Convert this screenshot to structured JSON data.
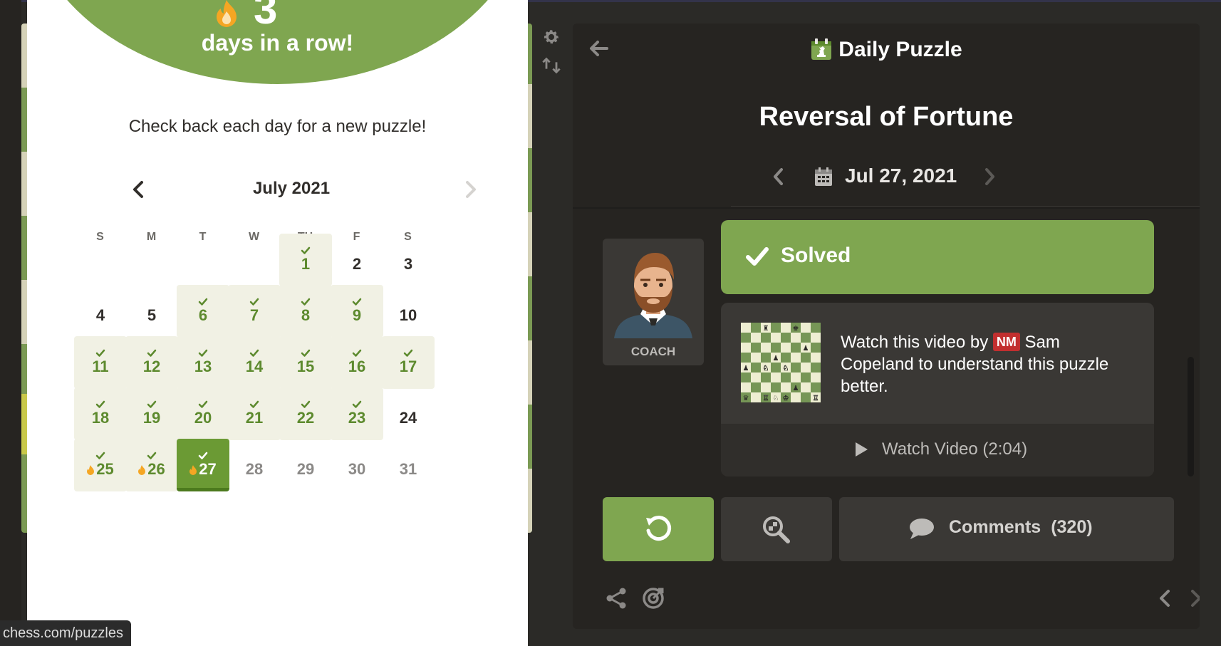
{
  "modal": {
    "streak_number": "3",
    "streak_text": "days in a row!",
    "check_back": "Check back each day for a new puzzle!",
    "calendar_title": "July 2021",
    "weekdays": [
      "S",
      "M",
      "T",
      "W",
      "TH",
      "F",
      "S"
    ],
    "days": [
      {
        "n": "1",
        "state": "solved"
      },
      {
        "n": "2",
        "state": "plain"
      },
      {
        "n": "3",
        "state": "plain"
      },
      {
        "n": "4",
        "state": "plain"
      },
      {
        "n": "5",
        "state": "plain"
      },
      {
        "n": "6",
        "state": "solved"
      },
      {
        "n": "7",
        "state": "solved"
      },
      {
        "n": "8",
        "state": "solved"
      },
      {
        "n": "9",
        "state": "solved"
      },
      {
        "n": "10",
        "state": "plain"
      },
      {
        "n": "11",
        "state": "solved"
      },
      {
        "n": "12",
        "state": "solved"
      },
      {
        "n": "13",
        "state": "solved"
      },
      {
        "n": "14",
        "state": "solved"
      },
      {
        "n": "15",
        "state": "solved"
      },
      {
        "n": "16",
        "state": "solved"
      },
      {
        "n": "17",
        "state": "solved"
      },
      {
        "n": "18",
        "state": "solved"
      },
      {
        "n": "19",
        "state": "solved"
      },
      {
        "n": "20",
        "state": "solved"
      },
      {
        "n": "21",
        "state": "solved"
      },
      {
        "n": "22",
        "state": "solved"
      },
      {
        "n": "23",
        "state": "solved"
      },
      {
        "n": "24",
        "state": "plain"
      },
      {
        "n": "25",
        "state": "streak"
      },
      {
        "n": "26",
        "state": "streak"
      },
      {
        "n": "27",
        "state": "today"
      },
      {
        "n": "28",
        "state": "future"
      },
      {
        "n": "29",
        "state": "future"
      },
      {
        "n": "30",
        "state": "future"
      },
      {
        "n": "31",
        "state": "future"
      }
    ],
    "first_weekday_index": 4
  },
  "status_url": "chess.com/puzzles",
  "panel": {
    "title": "Daily Puzzle",
    "puzzle_name": "Reversal of Fortune",
    "date": "Jul 27, 2021",
    "coach_label": "COACH",
    "solved_label": "Solved",
    "video_desc_before": "Watch this video by",
    "video_title_badge": "NM",
    "video_desc_after": "Sam Copeland to understand this puzzle better.",
    "watch_label": "Watch Video (2:04)",
    "comments_label": "Comments",
    "comments_count": "(320)"
  },
  "colors": {
    "accent_green": "#7fa650",
    "panel_bg": "#262421",
    "card_bg": "#3a3835",
    "solved_cell_bg": "#f1f1e4",
    "badge_red": "#c22f2f"
  },
  "icons": [
    "gear-icon",
    "flip-board-icon",
    "back-arrow-icon",
    "daily-puzzle-calendar-icon",
    "calendar-icon",
    "checkmark-icon",
    "play-icon",
    "retry-icon",
    "analysis-magnifier-icon",
    "comment-bubble-icon",
    "share-icon",
    "target-icon",
    "chevron-left-icon",
    "chevron-right-icon",
    "flame-icon"
  ]
}
